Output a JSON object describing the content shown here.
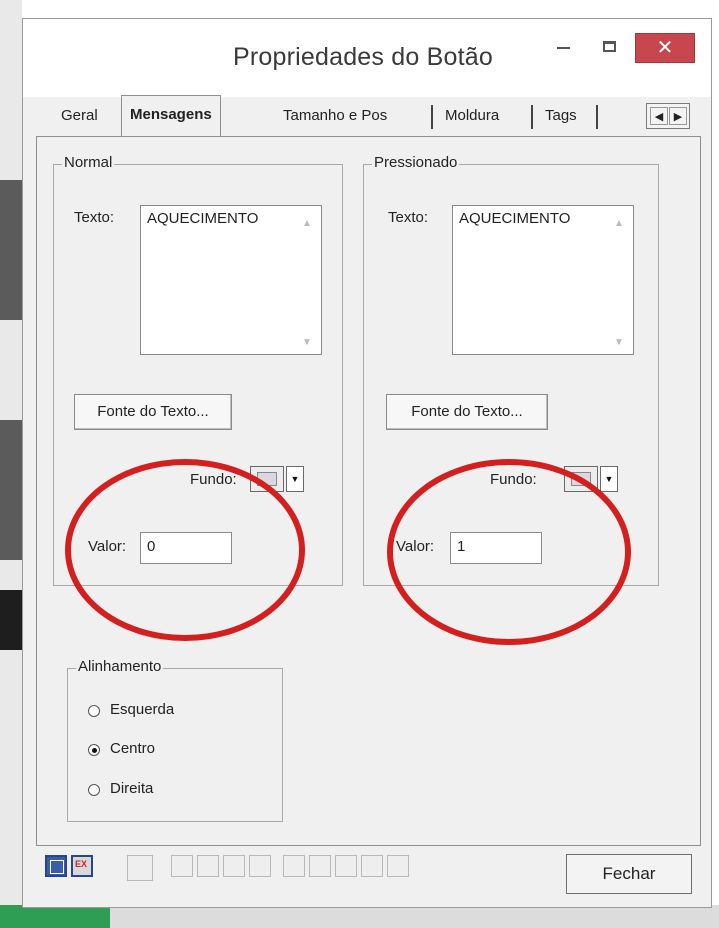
{
  "window": {
    "title": "Propriedades do Botão",
    "close_glyph": "✕"
  },
  "tabs": [
    {
      "label": "Geral",
      "active": false
    },
    {
      "label": "Mensagens",
      "active": true
    },
    {
      "label": "Tamanho e Pos",
      "active": false
    },
    {
      "label": "Moldura",
      "active": false
    },
    {
      "label": "Tags",
      "active": false
    }
  ],
  "tab_scroll": {
    "left": "◀",
    "right": "▶"
  },
  "normal": {
    "group_label": "Normal",
    "text_label": "Texto:",
    "text_value": "AQUECIMENTO",
    "font_button": "Fonte do Texto...",
    "bg_label": "Fundo:",
    "value_label": "Valor:",
    "value": "0"
  },
  "pressed": {
    "group_label": "Pressionado",
    "text_label": "Texto:",
    "text_value": "AQUECIMENTO",
    "font_button": "Fonte do Texto...",
    "bg_label": "Fundo:",
    "value_label": "Valor:",
    "value": "1"
  },
  "alignment": {
    "group_label": "Alinhamento",
    "options": [
      {
        "label": "Esquerda",
        "selected": false
      },
      {
        "label": "Centro",
        "selected": true
      },
      {
        "label": "Direita",
        "selected": false
      }
    ]
  },
  "footer": {
    "close_button": "Fechar"
  },
  "annotation_color": "#d41f1f"
}
